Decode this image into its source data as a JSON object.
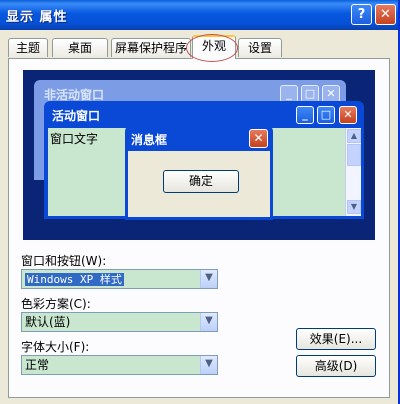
{
  "window": {
    "title": "显示 属性",
    "help_label": "?",
    "close_label": "✕"
  },
  "tabs": [
    {
      "label": "主题"
    },
    {
      "label": "桌面"
    },
    {
      "label": "屏幕保护程序"
    },
    {
      "label": "外观",
      "active": true
    },
    {
      "label": "设置"
    }
  ],
  "preview": {
    "inactive_window_title": "非活动窗口",
    "active_window_title": "活动窗口",
    "window_text": "窗口文字",
    "message_box_title": "消息框",
    "ok_label": "确定",
    "min_label": "_",
    "max_label": "□",
    "close_label": "✕"
  },
  "form": {
    "windows_buttons_label": "窗口和按钮(W):",
    "windows_buttons_value": "Windows XP 样式",
    "color_scheme_label": "色彩方案(C):",
    "color_scheme_value": "默认(蓝)",
    "font_size_label": "字体大小(F):",
    "font_size_value": "正常"
  },
  "buttons": {
    "effects_label": "效果(E)...",
    "advanced_label": "高级(D)"
  },
  "icons": {
    "dropdown": "chevron-down-icon",
    "scroll_up": "arrow-up-icon",
    "scroll_down": "arrow-down-icon"
  },
  "colors": {
    "titlebar": "#0858e0",
    "window_bg": "#ece9d8",
    "preview_bg": "#0a2476",
    "client_bg": "#c9e6cf",
    "selection": "#316ac5"
  }
}
